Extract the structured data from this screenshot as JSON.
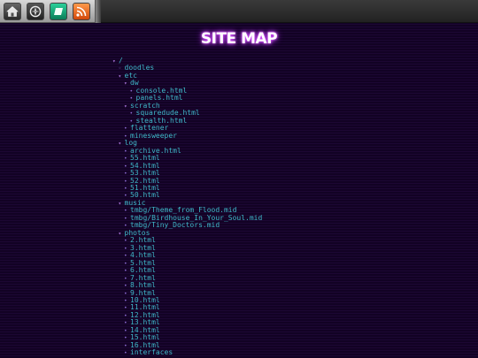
{
  "toolbar": {
    "buttons": [
      {
        "id": "home",
        "icon": "home-icon"
      },
      {
        "id": "nav",
        "icon": "compass-icon"
      },
      {
        "id": "tag",
        "icon": "tag-icon"
      },
      {
        "id": "rss",
        "icon": "rss-icon"
      }
    ]
  },
  "page": {
    "title": "SITE MAP"
  },
  "tree": [
    {
      "label": "/",
      "depth": 0,
      "kind": "folder-open"
    },
    {
      "label": "doodles",
      "depth": 1,
      "kind": "folder"
    },
    {
      "label": "etc",
      "depth": 1,
      "kind": "folder-open"
    },
    {
      "label": "dw",
      "depth": 2,
      "kind": "folder-open"
    },
    {
      "label": "console.html",
      "depth": 3,
      "kind": "file"
    },
    {
      "label": "panels.html",
      "depth": 3,
      "kind": "file"
    },
    {
      "label": "scratch",
      "depth": 2,
      "kind": "folder-open"
    },
    {
      "label": "squaredude.html",
      "depth": 3,
      "kind": "file"
    },
    {
      "label": "stealth.html",
      "depth": 3,
      "kind": "file"
    },
    {
      "label": "flattener",
      "depth": 2,
      "kind": "file"
    },
    {
      "label": "minesweeper",
      "depth": 2,
      "kind": "file"
    },
    {
      "label": "log",
      "depth": 1,
      "kind": "folder-open"
    },
    {
      "label": "archive.html",
      "depth": 2,
      "kind": "file"
    },
    {
      "label": "55.html",
      "depth": 2,
      "kind": "file"
    },
    {
      "label": "54.html",
      "depth": 2,
      "kind": "file"
    },
    {
      "label": "53.html",
      "depth": 2,
      "kind": "file"
    },
    {
      "label": "52.html",
      "depth": 2,
      "kind": "file"
    },
    {
      "label": "51.html",
      "depth": 2,
      "kind": "file"
    },
    {
      "label": "50.html",
      "depth": 2,
      "kind": "file"
    },
    {
      "label": "music",
      "depth": 1,
      "kind": "folder-open"
    },
    {
      "label": "tmbg/Theme_from_Flood.mid",
      "depth": 2,
      "kind": "file"
    },
    {
      "label": "tmbg/Birdhouse_In_Your_Soul.mid",
      "depth": 2,
      "kind": "file"
    },
    {
      "label": "tmbg/Tiny_Doctors.mid",
      "depth": 2,
      "kind": "file"
    },
    {
      "label": "photos",
      "depth": 1,
      "kind": "folder-open"
    },
    {
      "label": "2.html",
      "depth": 2,
      "kind": "file"
    },
    {
      "label": "3.html",
      "depth": 2,
      "kind": "file"
    },
    {
      "label": "4.html",
      "depth": 2,
      "kind": "file"
    },
    {
      "label": "5.html",
      "depth": 2,
      "kind": "file"
    },
    {
      "label": "6.html",
      "depth": 2,
      "kind": "file"
    },
    {
      "label": "7.html",
      "depth": 2,
      "kind": "file"
    },
    {
      "label": "8.html",
      "depth": 2,
      "kind": "file"
    },
    {
      "label": "9.html",
      "depth": 2,
      "kind": "file"
    },
    {
      "label": "10.html",
      "depth": 2,
      "kind": "file"
    },
    {
      "label": "11.html",
      "depth": 2,
      "kind": "file"
    },
    {
      "label": "12.html",
      "depth": 2,
      "kind": "file"
    },
    {
      "label": "13.html",
      "depth": 2,
      "kind": "file"
    },
    {
      "label": "14.html",
      "depth": 2,
      "kind": "file"
    },
    {
      "label": "15.html",
      "depth": 2,
      "kind": "file"
    },
    {
      "label": "16.html",
      "depth": 2,
      "kind": "file"
    },
    {
      "label": "interfaces",
      "depth": 2,
      "kind": "file"
    }
  ]
}
